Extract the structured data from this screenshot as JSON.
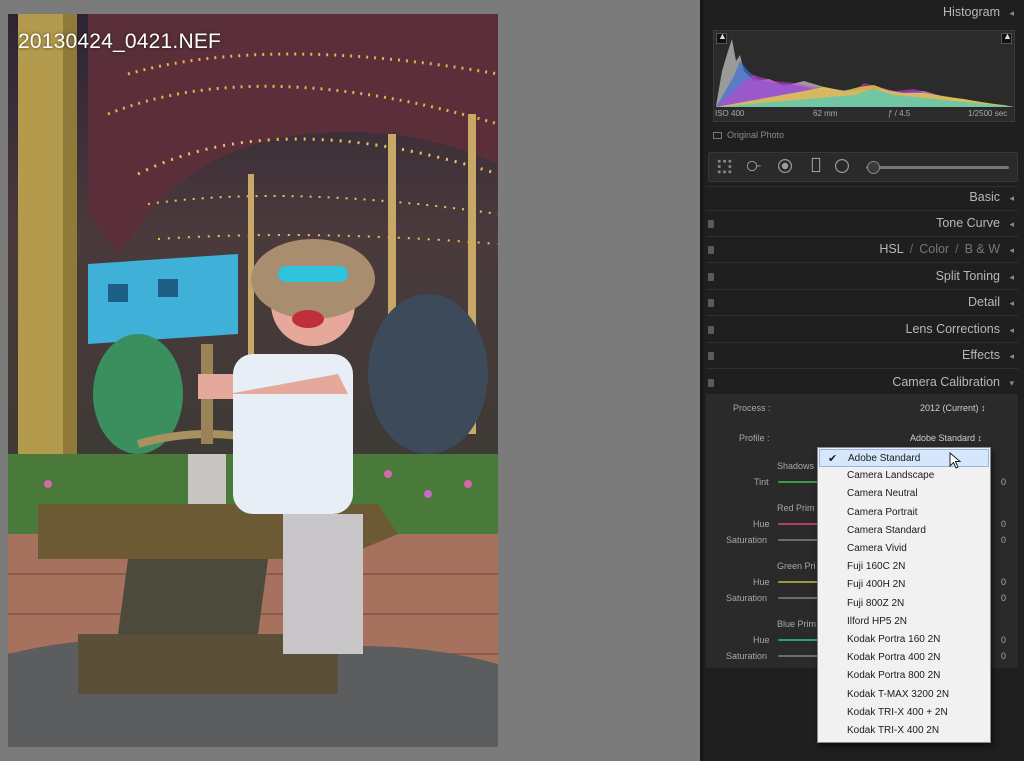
{
  "photo": {
    "filename": "20130424_0421.NEF"
  },
  "panel": {
    "histogram": {
      "title": "Histogram",
      "exif": {
        "iso": "ISO 400",
        "focal": "62 mm",
        "aperture": "ƒ / 4.5",
        "shutter": "1/2500 sec"
      },
      "original_photo_label": "Original Photo"
    },
    "sections": {
      "basic": "Basic",
      "tone_curve": "Tone Curve",
      "hsl": "HSL",
      "color": "Color",
      "bw": "B & W",
      "split_toning": "Split Toning",
      "detail": "Detail",
      "lens_corrections": "Lens Corrections",
      "effects": "Effects",
      "camera_calibration": "Camera Calibration"
    },
    "calibration": {
      "process_label": "Process :",
      "process_value": "2012 (Current) ↕",
      "profile_label": "Profile :",
      "profile_value": "Adobe Standard ↕",
      "shadows_label": "Shadows",
      "tint_label": "Tint",
      "red_primary_label": "Red Prim",
      "green_primary_label": "Green Pri",
      "blue_primary_label": "Blue Prim",
      "hue_label": "Hue",
      "saturation_label": "Saturation",
      "tint_value": "0",
      "red_hue_value": "0",
      "red_saturation_value": "0",
      "green_hue_value": "0",
      "green_saturation_value": "0",
      "blue_hue_value": "0",
      "blue_saturation_value": "0"
    }
  },
  "profile_menu": {
    "selected": "Adobe Standard",
    "items": [
      "Adobe Standard",
      "Camera Landscape",
      "Camera Neutral",
      "Camera Portrait",
      "Camera Standard",
      "Camera Vivid",
      "Fuji 160C 2N",
      "Fuji 400H 2N",
      "Fuji 800Z 2N",
      "Ilford HP5 2N",
      "Kodak Portra 160 2N",
      "Kodak Portra 400 2N",
      "Kodak Portra 800 2N",
      "Kodak T-MAX 3200 2N",
      "Kodak TRI-X 400 + 2N",
      "Kodak TRI-X 400 2N"
    ]
  },
  "colors": {
    "panel_bg": "#1f1f1f",
    "canvas_bg": "#7b7b7b",
    "menu_bg": "#f1f1f1",
    "selection": "#d6e7fb"
  }
}
